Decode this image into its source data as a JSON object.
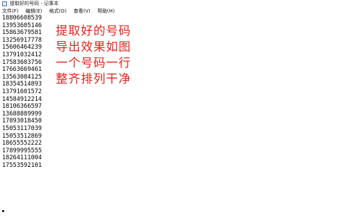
{
  "window": {
    "title": "提取好的号码 - 记事本",
    "icon": "notepad-icon"
  },
  "menu": [
    "文件(F)",
    "编辑(E)",
    "格式(O)",
    "查看(V)",
    "帮助(H)"
  ],
  "editor": {
    "lines": [
      "18806608539",
      "13953605146",
      "15863679581",
      "13256917778",
      "15606464239",
      "13791032412",
      "17583603756",
      "17663669461",
      "13563084125",
      "18354514893",
      "13791601572",
      "14584912214",
      "18106366597",
      "13688889999",
      "17893018450",
      "15053117039",
      "15053512869",
      "18655552222",
      "17899995555",
      "18264111004",
      "17553592101"
    ]
  },
  "annotation": {
    "lines": [
      "提取好的号码",
      "导出效果如图",
      "一个号码一行",
      "整齐排列干净"
    ],
    "color": "#e6211b"
  }
}
